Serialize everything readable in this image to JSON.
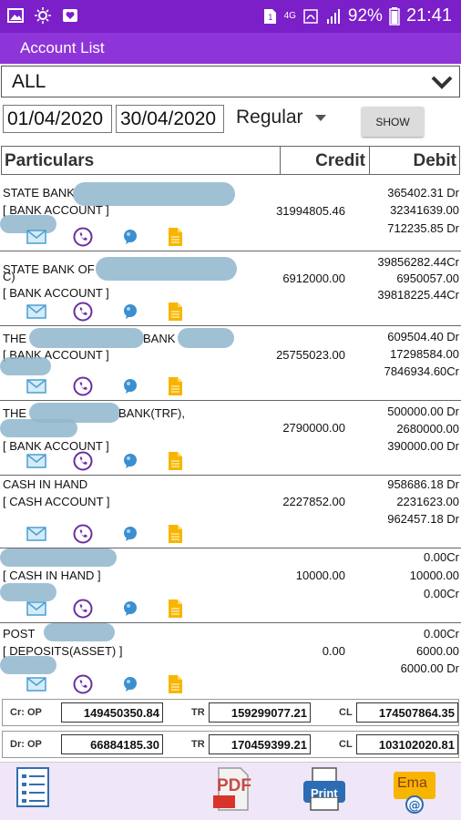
{
  "status": {
    "network": "4G",
    "battery": "92%",
    "time": "21:41"
  },
  "appbar": {
    "title": "Account List"
  },
  "filter": {
    "value": "ALL"
  },
  "dates": {
    "from": "01/04/2020",
    "to": "30/04/2020"
  },
  "mode": {
    "value": "Regular"
  },
  "show_button": "SHOW",
  "table": {
    "headers": {
      "particulars": "Particulars",
      "credit": "Credit",
      "debit": "Debit"
    },
    "rows": [
      {
        "name": "STATE BANK",
        "type": "[ BANK ACCOUNT ]",
        "credit": "31994805.46",
        "debits": [
          "365402.31 Dr",
          "32341639.00",
          "712235.85 Dr"
        ]
      },
      {
        "name": "STATE BANK OF",
        "name2": "C)",
        "type": "[ BANK ACCOUNT ]",
        "credit": "6912000.00",
        "debits": [
          "39856282.44Cr",
          "6950057.00",
          "39818225.44Cr"
        ]
      },
      {
        "name": "THE",
        "name_suffix": "BANK",
        "type": "[ BANK ACCOUNT ]",
        "credit": "25755023.00",
        "debits": [
          "609504.40 Dr",
          "17298584.00",
          "7846934.60Cr"
        ]
      },
      {
        "name": "THE",
        "name_suffix": "BANK(TRF),",
        "type": "[ BANK ACCOUNT ]",
        "credit": "2790000.00",
        "debits": [
          "500000.00 Dr",
          "2680000.00",
          "390000.00 Dr"
        ]
      },
      {
        "name": "CASH IN HAND",
        "type": "[ CASH ACCOUNT ]",
        "credit": "2227852.00",
        "debits": [
          "958686.18 Dr",
          "2231623.00",
          "962457.18 Dr"
        ]
      },
      {
        "name": "",
        "type": "[ CASH IN HAND ]",
        "credit": "10000.00",
        "debits": [
          "0.00Cr",
          "10000.00",
          "0.00Cr"
        ]
      },
      {
        "name": "POST",
        "type": "[ DEPOSITS(ASSET) ]",
        "credit": "0.00",
        "debits": [
          "0.00Cr",
          "6000.00",
          "6000.00 Dr"
        ]
      }
    ]
  },
  "totals": {
    "cr": {
      "label": "Cr: OP",
      "op": "149450350.84",
      "tr_label": "TR",
      "tr": "159299077.21",
      "cl_label": "CL",
      "cl": "174507864.35"
    },
    "dr": {
      "label": "Dr: OP",
      "op": "66884185.30",
      "tr_label": "TR",
      "tr": "170459399.21",
      "cl_label": "CL",
      "cl": "103102020.81"
    }
  },
  "bottom": {
    "pdf_label": "PDF",
    "print_label": "Print",
    "email_label": "Ema"
  },
  "colors": {
    "statusbar": "#7b1fc8",
    "appbar": "#8e35d9",
    "accent_purple": "#6a2fa0"
  }
}
